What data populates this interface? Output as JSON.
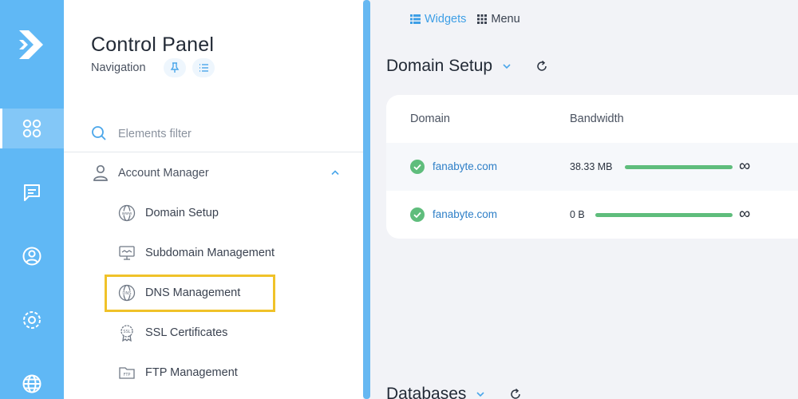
{
  "rail": {
    "items": [
      {
        "icon": "apps-grid-icon",
        "active": true
      },
      {
        "icon": "chat-icon",
        "active": false
      },
      {
        "icon": "user-circle-icon",
        "active": false
      },
      {
        "icon": "settings-icon",
        "active": false
      },
      {
        "icon": "globe-icon",
        "active": false
      }
    ],
    "logo_icon": "logo-arrow-icon"
  },
  "nav": {
    "title": "Control Panel",
    "subtitle": "Navigation",
    "filter_placeholder": "Elements filter",
    "account_manager": "Account Manager",
    "items": [
      {
        "label": "Domain Setup",
        "icon": "www-globe-icon"
      },
      {
        "label": "Subdomain Management",
        "icon": "monitor-icon"
      },
      {
        "label": "DNS Management",
        "icon": "dns-globe-icon"
      },
      {
        "label": "SSL Certificates",
        "icon": "ssl-badge-icon"
      },
      {
        "label": "FTP Management",
        "icon": "ftp-folder-icon"
      }
    ],
    "highlighted_item": "DNS Management"
  },
  "toolbar": {
    "widgets": "Widgets",
    "menu": "Menu"
  },
  "domain_setup": {
    "title": "Domain Setup",
    "columns": {
      "domain": "Domain",
      "bandwidth": "Bandwidth"
    },
    "rows": [
      {
        "domain": "fanabyte.com",
        "bandwidth": "38.33 MB",
        "limit": "∞"
      },
      {
        "domain": "fanabyte.com",
        "bandwidth": "0 B",
        "limit": "∞"
      }
    ]
  },
  "databases": {
    "title": "Databases"
  },
  "colors": {
    "rail": "#60b8f5",
    "accent": "#3e9fe6",
    "link": "#2e7fc7",
    "success": "#5fbd7c",
    "highlight": "#f0c229"
  }
}
